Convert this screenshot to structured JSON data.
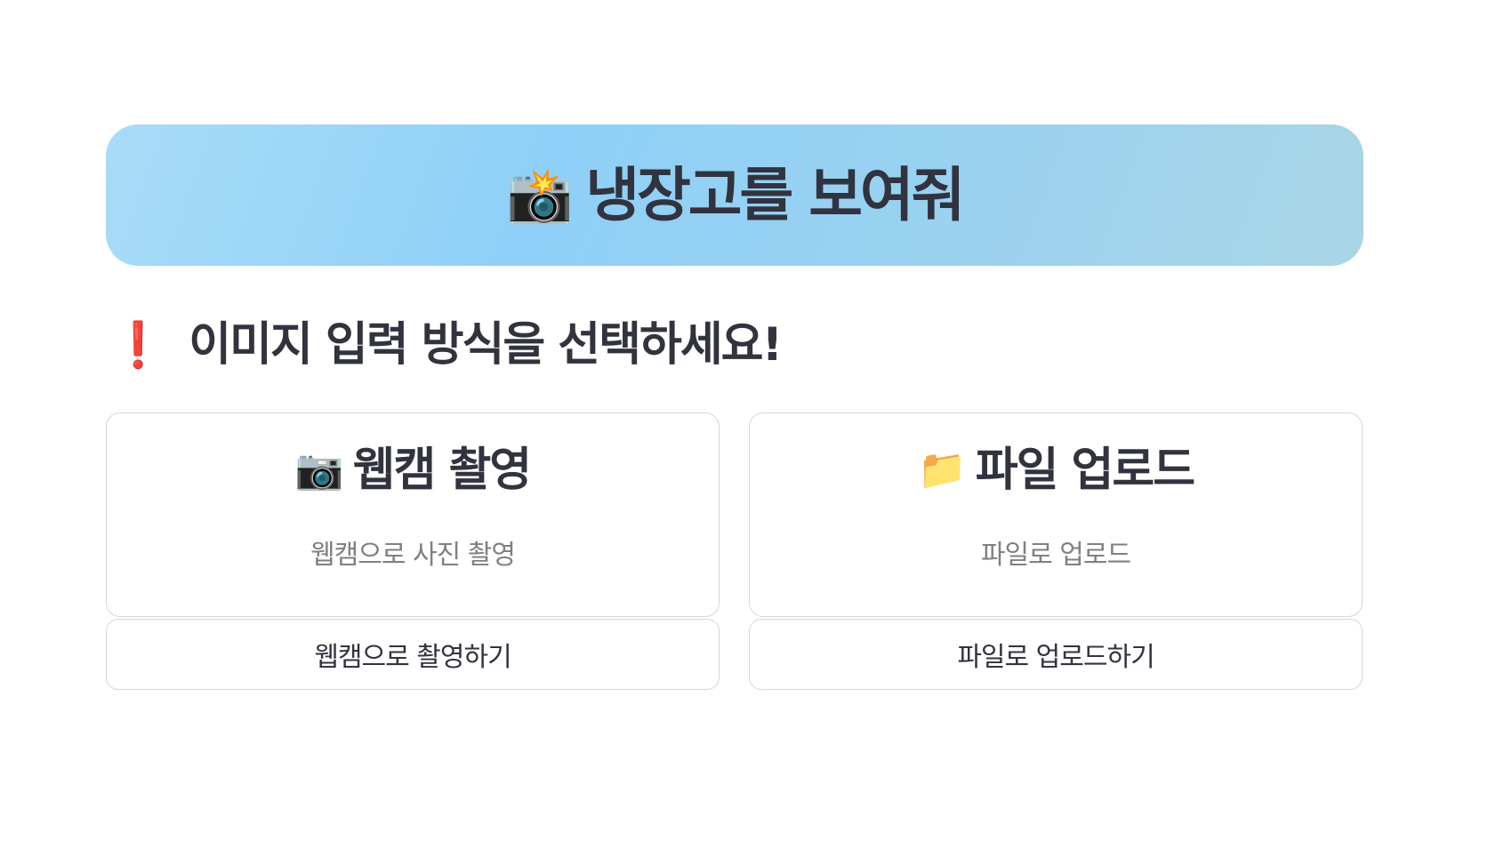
{
  "hero": {
    "icon": "📸",
    "icon_name": "camera-flash-icon",
    "title": "냉장고를 보여줘",
    "gradient": [
      "#a8dcf8",
      "#8fd0f8",
      "#a9d6e6"
    ]
  },
  "subheader": {
    "icon": "❗",
    "icon_name": "exclamation-icon",
    "text": "이미지 입력 방식을 선택하세요!"
  },
  "options": [
    {
      "icon": "📷",
      "icon_name": "camera-icon",
      "title": "웹캠 촬영",
      "description": "웹캠으로 사진 촬영",
      "button_label": "웹캠으로 촬영하기"
    },
    {
      "icon": "📁",
      "icon_name": "folder-icon",
      "title": "파일 업로드",
      "description": "파일로 업로드",
      "button_label": "파일로 업로드하기"
    }
  ],
  "colors": {
    "text": "#31333f",
    "muted": "#808080",
    "alert": "#e00000",
    "border": "#d6d6d9"
  }
}
